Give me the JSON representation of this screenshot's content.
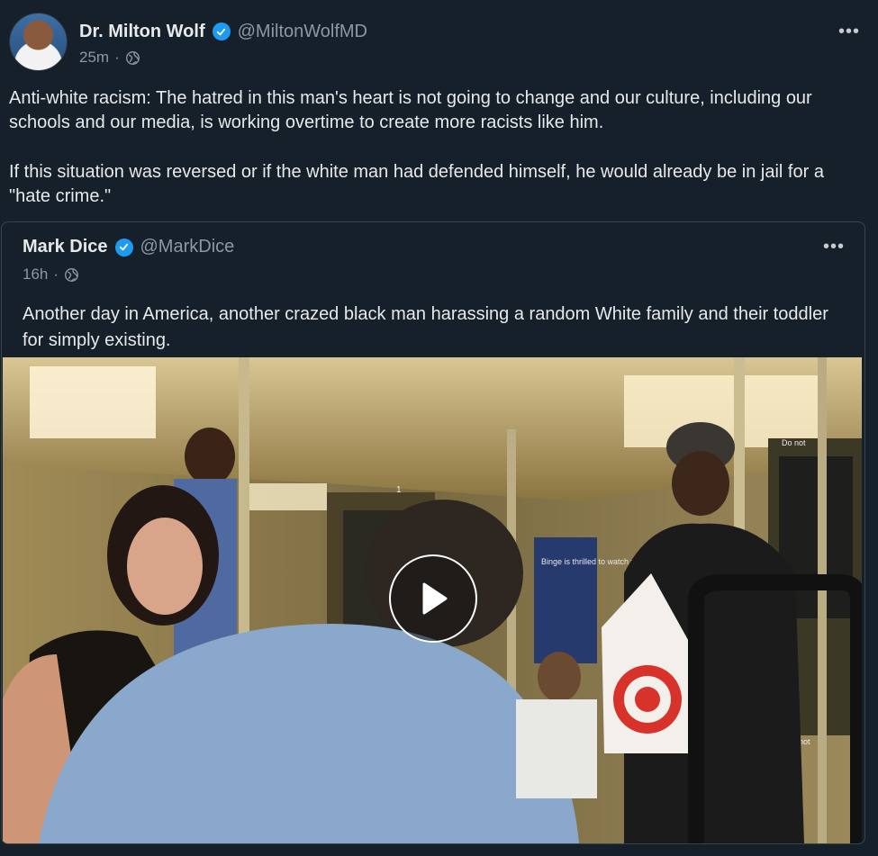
{
  "post": {
    "author_name": "Dr. Milton Wolf",
    "handle": "@MiltonWolfMD",
    "time": "25m",
    "separator": "·",
    "text_paragraphs": [
      "Anti-white racism: The hatred in this man's heart is not going to change and our culture, including our schools and our media, is working overtime to create more racists like him.",
      "If this situation was reversed or if the white man had defended himself, he would already be in jail for a \"hate crime.\""
    ],
    "more_label": "•••"
  },
  "quoted": {
    "author_name": "Mark Dice",
    "handle": "@MarkDice",
    "time": "16h",
    "separator": "·",
    "text": "Another day in America, another crazed black man harassing a random White family and their toddler for simply existing.",
    "more_label": "•••"
  },
  "video": {
    "ad_text": "Binge is thrilled to watch when people fall in love",
    "door_sign": "Do not",
    "door_sign_2": "Do not",
    "car_number": "1"
  },
  "colors": {
    "background": "#15202b",
    "verified": "#1d9bf0",
    "secondary_text": "#8b98a5",
    "border": "#38444d"
  },
  "icons": [
    "verified-badge-icon",
    "globe-icon",
    "more-options-icon",
    "play-icon"
  ]
}
